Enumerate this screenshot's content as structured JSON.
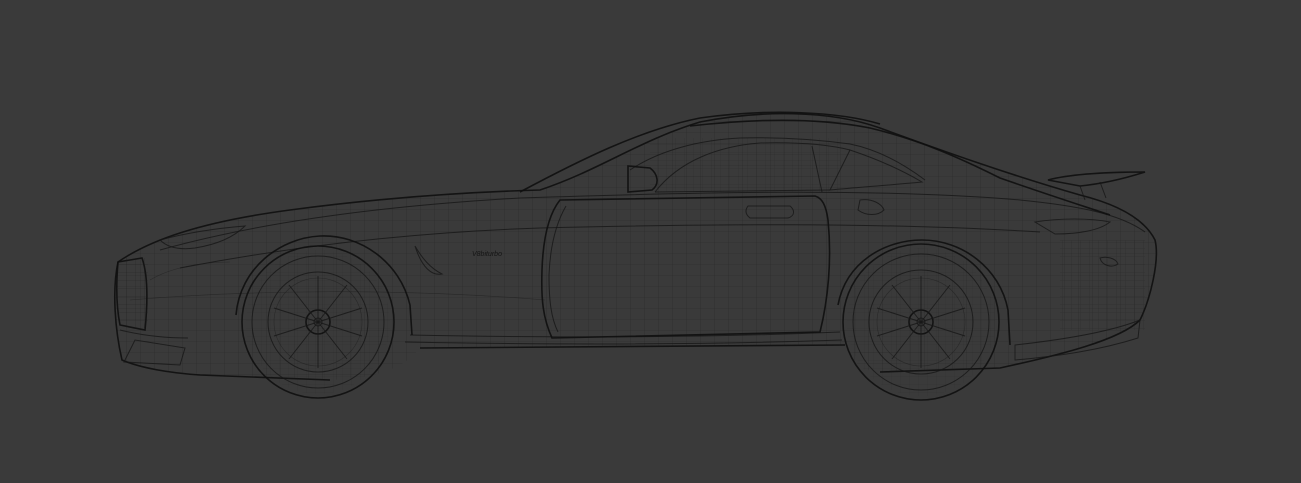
{
  "viewport": {
    "background_color": "#3a3a3a",
    "wire_color": "#161616",
    "shading_mode": "wireframe",
    "view": "side"
  },
  "model": {
    "subject": "car",
    "fender_badge": "V8biturbo"
  }
}
